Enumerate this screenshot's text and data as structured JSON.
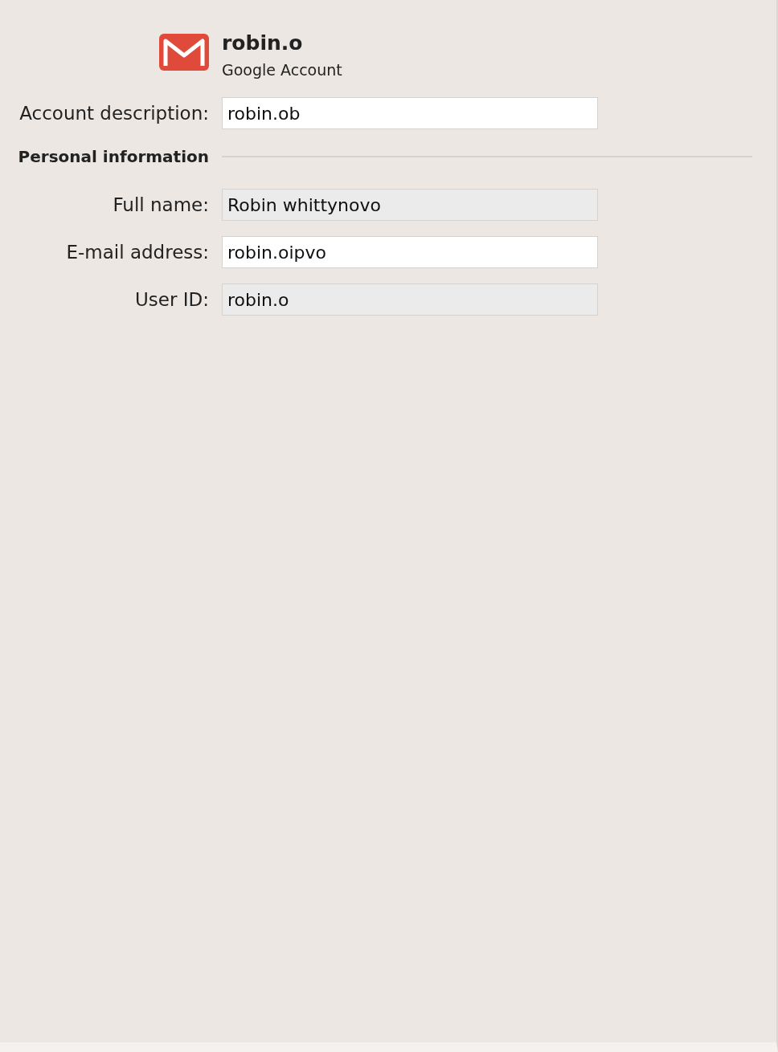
{
  "account": {
    "name": "robin.o",
    "type": "Google Account"
  },
  "description": {
    "label": "Account description:",
    "value": "robin.ob",
    "disabled": false
  },
  "section": {
    "title": "Personal information"
  },
  "fields": [
    {
      "label": "Full name:",
      "value": "Robin whittynovo",
      "disabled": true
    },
    {
      "label": "E-mail address:",
      "value": "robin.oipvo",
      "disabled": false
    },
    {
      "label": "User ID:",
      "value": "robin.o",
      "disabled": true
    }
  ]
}
